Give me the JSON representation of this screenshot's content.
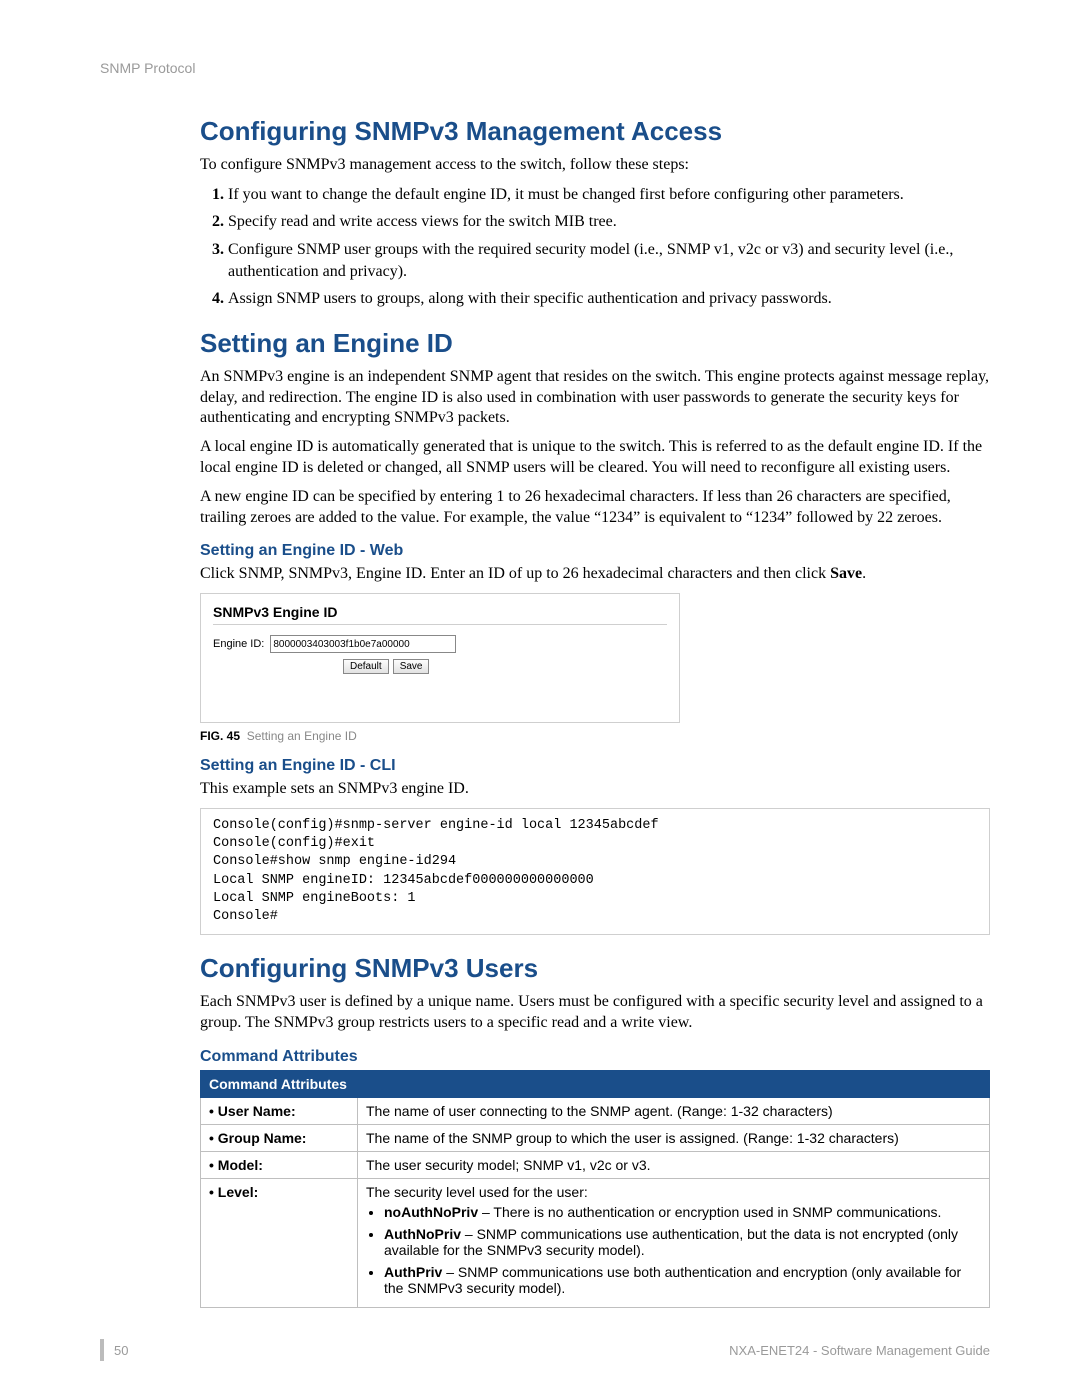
{
  "runningHeader": "SNMP Protocol",
  "h1_1": "Configuring SNMPv3 Management Access",
  "intro1": "To configure SNMPv3 management access to the switch, follow these steps:",
  "steps": [
    "If you want to change the default engine ID, it must be changed first before configuring other parameters.",
    "Specify read and write access views for the switch MIB tree.",
    "Configure SNMP user groups with the required security model (i.e., SNMP v1, v2c or v3) and security level (i.e., authentication and privacy).",
    "Assign SNMP users to groups, along with their specific authentication and privacy passwords."
  ],
  "h1_2": "Setting an Engine ID",
  "p_engine1": "An SNMPv3 engine is an independent SNMP agent that resides on the switch. This engine protects against message replay, delay, and redirection. The engine ID is also used in combination with user passwords to generate the security keys for authenticating and encrypting SNMPv3 packets.",
  "p_engine2": "A local engine ID is automatically generated that is unique to the switch. This is referred to as the default engine ID. If the local engine ID is deleted or changed, all SNMP users will be cleared. You will need to reconfigure all existing users.",
  "p_engine3": "A new engine ID can be specified by entering 1 to 26 hexadecimal characters. If less than 26 characters are specified, trailing zeroes are added to the value. For example, the value “1234” is equivalent to “1234” followed by 22 zeroes.",
  "h2_web": "Setting an Engine ID - Web",
  "p_web": "Click SNMP, SNMPv3, Engine ID. Enter an ID of up to 26 hexadecimal characters and then click ",
  "p_web_bold": "Save",
  "p_web_end": ".",
  "fig": {
    "boxTitle": "SNMPv3 Engine ID",
    "fieldLabel": "Engine ID:",
    "fieldValue": "8000003403003f1b0e7a00000",
    "btnDefault": "Default",
    "btnSave": "Save",
    "captionPrefix": "FIG. 45",
    "captionText": "Setting an Engine ID"
  },
  "h2_cli": "Setting an Engine ID - CLI",
  "p_cli": "This example sets an SNMPv3 engine ID.",
  "code": "Console(config)#snmp-server engine-id local 12345abcdef\nConsole(config)#exit\nConsole#show snmp engine-id294\nLocal SNMP engineID: 12345abcdef000000000000000\nLocal SNMP engineBoots: 1\nConsole#",
  "h1_3": "Configuring SNMPv3 Users",
  "p_users": "Each SNMPv3 user is defined by a unique name. Users must be configured with a specific security level and assigned to a group. The SNMPv3 group restricts users to a specific read and a write view.",
  "h2_cmd": "Command Attributes",
  "table": {
    "header": "Command Attributes",
    "rows": [
      {
        "label": "• User Name:",
        "desc": "The name of user connecting to the SNMP agent. (Range: 1-32 characters)"
      },
      {
        "label": "• Group Name:",
        "desc": "The name of the SNMP group to which the user is assigned. (Range: 1-32 characters)"
      },
      {
        "label": "• Model:",
        "desc": "The user security model; SNMP v1, v2c or v3."
      }
    ],
    "levelLabel": "• Level:",
    "levelIntro": "The security level used for the user:",
    "levelItems": [
      {
        "b": "noAuthNoPriv",
        "t": " – There is no authentication or encryption used in SNMP communications."
      },
      {
        "b": "AuthNoPriv",
        "t": " – SNMP communications use authentication, but the data is not encrypted (only available for the SNMPv3 security model)."
      },
      {
        "b": "AuthPriv",
        "t": " – SNMP communications use both authentication and encryption (only available for the SNMPv3 security model)."
      }
    ]
  },
  "footer": {
    "pageNum": "50",
    "docTitle": "NXA-ENET24 - Software Management Guide"
  }
}
